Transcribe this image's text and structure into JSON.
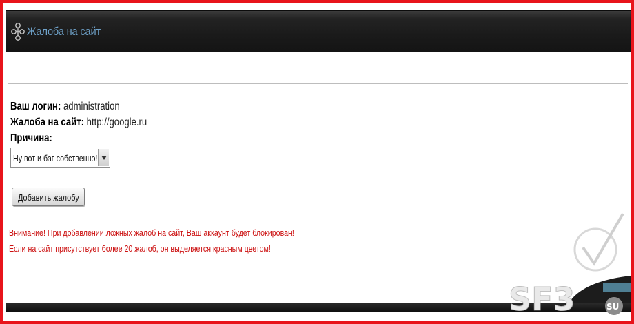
{
  "window": {
    "title": "Жалоба на сайт"
  },
  "form": {
    "login_label": "Ваш логин:",
    "login_value": "administration",
    "site_label": "Жалоба на сайт:",
    "site_value": "http://google.ru",
    "reason_label": "Причина:",
    "reason_selected": "Ну вот и баг собственно!",
    "submit_label": "Добавить жалобу"
  },
  "warnings": [
    "Внимание! При добавлении ложных жалоб на сайт, Ваш аккаунт будет блокирован!",
    "Если на сайт присутствует более 20 жалоб, он выделяется красным цветом!"
  ],
  "watermark": {
    "brand": "SF3",
    "tld": "SU"
  },
  "colors": {
    "frame_border": "#e8141b",
    "title_text": "#6fa2c9",
    "warning_text": "#cc1111",
    "titlebar_bg": "#1a1a1a"
  }
}
